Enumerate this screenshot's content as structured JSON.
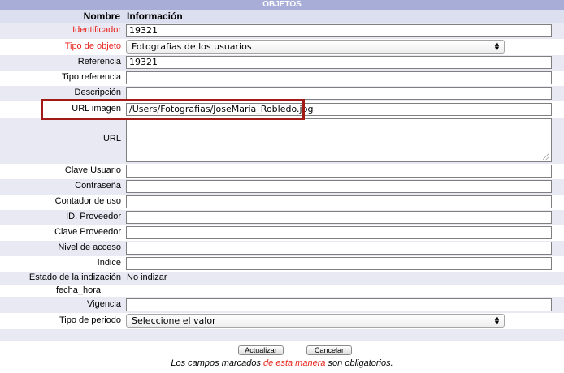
{
  "title": "OBJETOS",
  "header": {
    "name": "Nombre",
    "info": "Información"
  },
  "fields": {
    "identificador": {
      "label": "Identificador",
      "value": "19321"
    },
    "tipo_objeto": {
      "label": "Tipo de objeto",
      "value": "Fotografias de los usuarios"
    },
    "referencia": {
      "label": "Referencia",
      "value": "19321"
    },
    "tipo_referencia": {
      "label": "Tipo referencia",
      "value": ""
    },
    "descripcion": {
      "label": "Descripción",
      "value": ""
    },
    "url_imagen": {
      "label": "URL imagen",
      "value": "/Users/Fotografias/JoseMaria_Robledo.jpg"
    },
    "url": {
      "label": "URL",
      "value": ""
    },
    "clave_usuario": {
      "label": "Clave Usuario",
      "value": ""
    },
    "contrasena": {
      "label": "Contraseña",
      "value": ""
    },
    "contador_uso": {
      "label": "Contador de uso",
      "value": ""
    },
    "id_proveedor": {
      "label": "ID. Proveedor",
      "value": ""
    },
    "clave_proveedor": {
      "label": "Clave Proveedor",
      "value": ""
    },
    "nivel_acceso": {
      "label": "Nivel de acceso",
      "value": ""
    },
    "indice": {
      "label": "Indice",
      "value": ""
    },
    "estado_indizacion": {
      "label": "Estado de la indización",
      "value": "No indizar"
    },
    "fecha_hora": {
      "label": "fecha_hora",
      "value": ""
    },
    "vigencia": {
      "label": "Vigencia",
      "value": ""
    },
    "tipo_periodo": {
      "label": "Tipo de periodo",
      "value": "Seleccione el valor"
    }
  },
  "buttons": {
    "update": "Actualizar",
    "cancel": "Cancelar"
  },
  "note": {
    "before": "Los campos marcados ",
    "red": "de esta manera",
    "after": " son obligatorios."
  },
  "colors": {
    "required": "#e8231c",
    "title_bar": "#a8add8",
    "row_alt": "#e8e9f3",
    "highlight": "#a11a16"
  }
}
